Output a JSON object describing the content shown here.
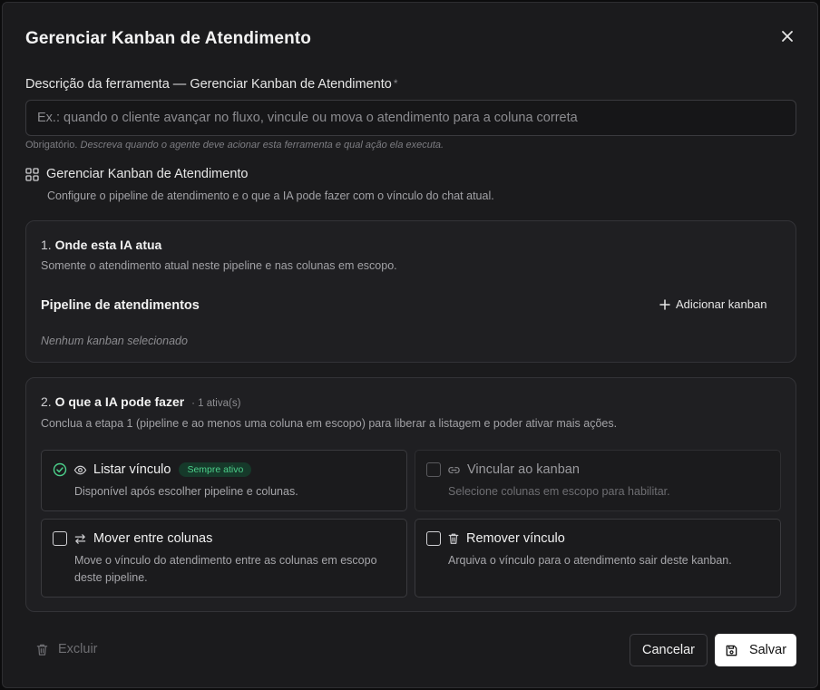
{
  "modal": {
    "title": "Gerenciar Kanban de Atendimento"
  },
  "description_field": {
    "label": "Descrição da ferramenta — Gerenciar Kanban de Atendimento",
    "required_mark": "*",
    "value": "",
    "placeholder": "Ex.: quando o cliente avançar no fluxo, vincule ou mova o atendimento para a coluna correta",
    "hint_prefix": "Obrigatório.",
    "hint_text": "Descreva quando o agente deve acionar esta ferramenta e qual ação ela executa."
  },
  "tool": {
    "icon": "grid-icon",
    "title": "Gerenciar Kanban de Atendimento",
    "subtitle": "Configure o pipeline de atendimento e o que a IA pode fazer com o vínculo do chat atual."
  },
  "step1": {
    "number": "1.",
    "title": "Onde esta IA atua",
    "subtitle": "Somente o atendimento atual neste pipeline e nas colunas em escopo.",
    "pipeline_title": "Pipeline de atendimentos",
    "add_label": "Adicionar kanban",
    "empty_text": "Nenhum kanban selecionado"
  },
  "step2": {
    "number": "2.",
    "title": "O que a IA pode fazer",
    "count": "· 1 ativa(s)",
    "subtitle": "Conclua a etapa 1 (pipeline e ao menos uma coluna em escopo) para liberar a listagem e poder ativar mais ações.",
    "actions": [
      {
        "title": "Listar vínculo",
        "badge": "Sempre ativo",
        "description": "Disponível após escolher pipeline e colunas.",
        "icon": "eye-icon",
        "state": "always-on"
      },
      {
        "title": "Vincular ao kanban",
        "description": "Selecione colunas em escopo para habilitar.",
        "icon": "link-icon",
        "state": "disabled"
      },
      {
        "title": "Mover entre colunas",
        "description": "Move o vínculo do atendimento entre as colunas em escopo deste pipeline.",
        "icon": "arrows-swap-icon",
        "state": "unchecked"
      },
      {
        "title": "Remover vínculo",
        "description": "Arquiva o vínculo para o atendimento sair deste kanban.",
        "icon": "trash-icon",
        "state": "unchecked"
      }
    ]
  },
  "footer": {
    "delete_label": "Excluir",
    "cancel_label": "Cancelar",
    "save_label": "Salvar"
  },
  "colors": {
    "background": "#1b1b1d",
    "card": "#1f1f22",
    "accent_green": "#4ccf8a",
    "save_button": "#ffffff"
  }
}
